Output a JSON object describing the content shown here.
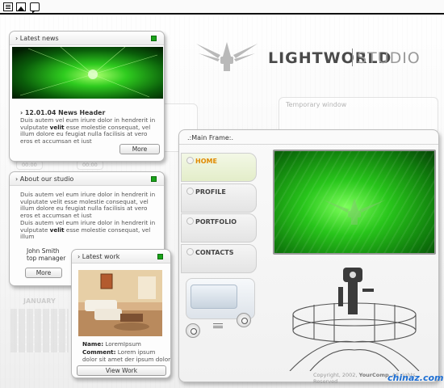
{
  "toolbar": {
    "icons": [
      "window-icon",
      "image-icon",
      "chat-icon"
    ]
  },
  "brand": {
    "name": "LIGHTWORLD",
    "studio": "STUDIO"
  },
  "ghosts": {
    "temporary_title": "Temporary window",
    "calendar_month": "JANUARY",
    "time_a": "00:00",
    "time_b": "00:00"
  },
  "latest_news": {
    "title": "Latest news",
    "headline": "12.01.04 News Header",
    "body_start": "Duis autem vel eum iriure dolor in hendrerit in vulputate ",
    "body_bold": "velit",
    "body_end": " esse molestie consequat, vel illum dolore eu feugiat nulla facilisis at vero eros et accumsan et iust",
    "more_label": "More"
  },
  "about": {
    "title": "About our studio",
    "p1": "Duis autem vel eum iriure dolor in hendrerit in vulputate velit esse molestie consequat, vel illum dolore eu feugiat nulla facilisis at vero eros et accumsan et iust",
    "p2_start": "Duis autem vel eum iriure dolor in hendrerit in vulputate ",
    "p2_bold": "velit",
    "p2_end": " esse molestie consequat, vel illum",
    "person_name": "John Smith",
    "person_role": "top manager",
    "more_label": "More"
  },
  "latest_work": {
    "title": "Latest work",
    "name_label": "Name:",
    "name_value": "LoremIpsum",
    "comment_label": "Comment:",
    "comment_value": "Lorem ipsum dolor sit amet der ipsum dolor",
    "view_label": "View Work"
  },
  "main_frame": {
    "title": ".:Main Frame:.",
    "nav": [
      "HOME",
      "PROFILE",
      "PORTFOLIO",
      "CONTACTS"
    ],
    "active_nav": "HOME",
    "copyright_prefix": "Copyright, 2002, ",
    "copyright_company": "YourComp",
    "copyright_suffix": ", All rights Reserved"
  },
  "watermark": "chinaz.com",
  "colors": {
    "accent_green": "#19a319",
    "active_nav": "#e08a00",
    "watermark_blue": "#1e6fd3"
  }
}
